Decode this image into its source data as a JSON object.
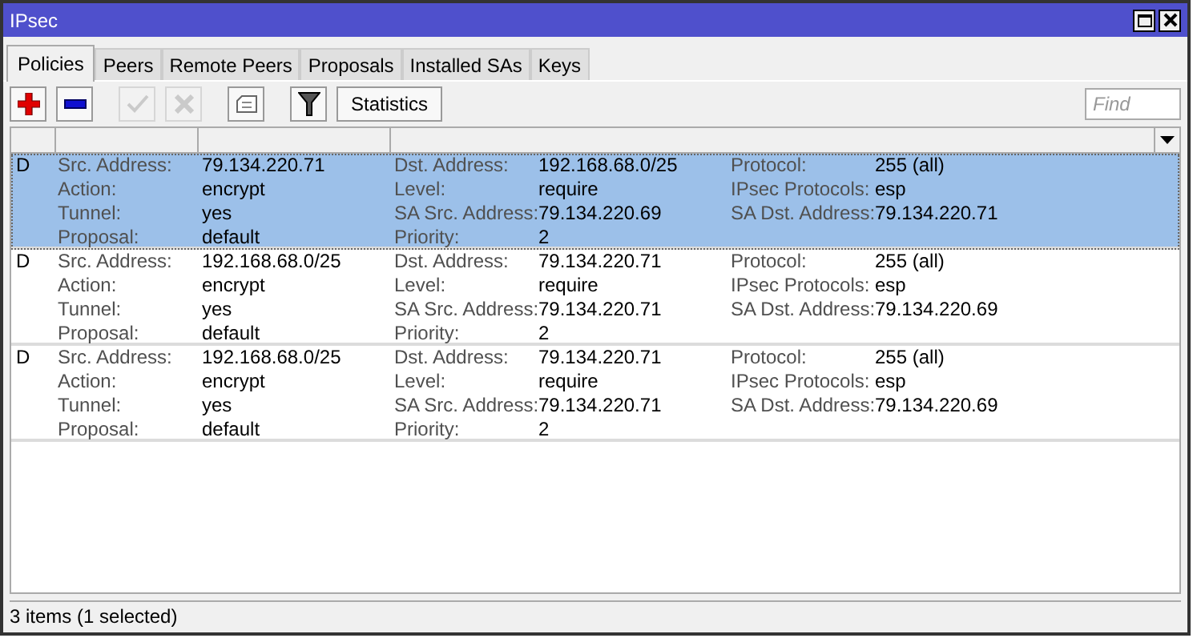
{
  "window": {
    "title": "IPsec"
  },
  "tabs": [
    {
      "label": "Policies",
      "selected": true
    },
    {
      "label": "Peers",
      "selected": false
    },
    {
      "label": "Remote Peers",
      "selected": false
    },
    {
      "label": "Proposals",
      "selected": false
    },
    {
      "label": "Installed SAs",
      "selected": false
    },
    {
      "label": "Keys",
      "selected": false
    }
  ],
  "toolbar": [
    {
      "kind": "add",
      "disabled": false
    },
    {
      "kind": "remove",
      "disabled": false
    },
    {
      "kind": "enable",
      "disabled": true
    },
    {
      "kind": "disable",
      "disabled": true
    },
    {
      "kind": "comment",
      "disabled": false
    },
    {
      "kind": "filter",
      "disabled": false
    },
    {
      "kind": "text",
      "label": "Statistics",
      "disabled": false
    }
  ],
  "search": {
    "placeholder": "Find"
  },
  "rows": [
    {
      "flag": "D",
      "selected": true,
      "fields": [
        {
          "label": "Src. Address:",
          "value": "79.134.220.71"
        },
        {
          "label": "Dst. Address:",
          "value": "192.168.68.0/25"
        },
        {
          "label": "Protocol:",
          "value": "255 (all)"
        },
        {
          "label": "Action:",
          "value": "encrypt"
        },
        {
          "label": "Level:",
          "value": "require"
        },
        {
          "label": "IPsec Protocols:",
          "value": "esp"
        },
        {
          "label": "Tunnel:",
          "value": "yes"
        },
        {
          "label": "SA Src. Address:",
          "value": "79.134.220.69"
        },
        {
          "label": "SA Dst. Address:",
          "value": "79.134.220.71"
        },
        {
          "label": "Proposal:",
          "value": "default"
        },
        {
          "label": "Priority:",
          "value": "2"
        }
      ]
    },
    {
      "flag": "D",
      "selected": false,
      "fields": [
        {
          "label": "Src. Address:",
          "value": "192.168.68.0/25"
        },
        {
          "label": "Dst. Address:",
          "value": "79.134.220.71"
        },
        {
          "label": "Protocol:",
          "value": "255 (all)"
        },
        {
          "label": "Action:",
          "value": "encrypt"
        },
        {
          "label": "Level:",
          "value": "require"
        },
        {
          "label": "IPsec Protocols:",
          "value": "esp"
        },
        {
          "label": "Tunnel:",
          "value": "yes"
        },
        {
          "label": "SA Src. Address:",
          "value": "79.134.220.71"
        },
        {
          "label": "SA Dst. Address:",
          "value": "79.134.220.69"
        },
        {
          "label": "Proposal:",
          "value": "default"
        },
        {
          "label": "Priority:",
          "value": "2"
        }
      ]
    },
    {
      "flag": "D",
      "selected": false,
      "fields": [
        {
          "label": "Src. Address:",
          "value": "192.168.68.0/25"
        },
        {
          "label": "Dst. Address:",
          "value": "79.134.220.71"
        },
        {
          "label": "Protocol:",
          "value": "255 (all)"
        },
        {
          "label": "Action:",
          "value": "encrypt"
        },
        {
          "label": "Level:",
          "value": "require"
        },
        {
          "label": "IPsec Protocols:",
          "value": "esp"
        },
        {
          "label": "Tunnel:",
          "value": "yes"
        },
        {
          "label": "SA Src. Address:",
          "value": "79.134.220.71"
        },
        {
          "label": "SA Dst. Address:",
          "value": "79.134.220.69"
        },
        {
          "label": "Proposal:",
          "value": "default"
        },
        {
          "label": "Priority:",
          "value": "2"
        }
      ]
    }
  ],
  "status_bar": "3 items (1 selected)"
}
